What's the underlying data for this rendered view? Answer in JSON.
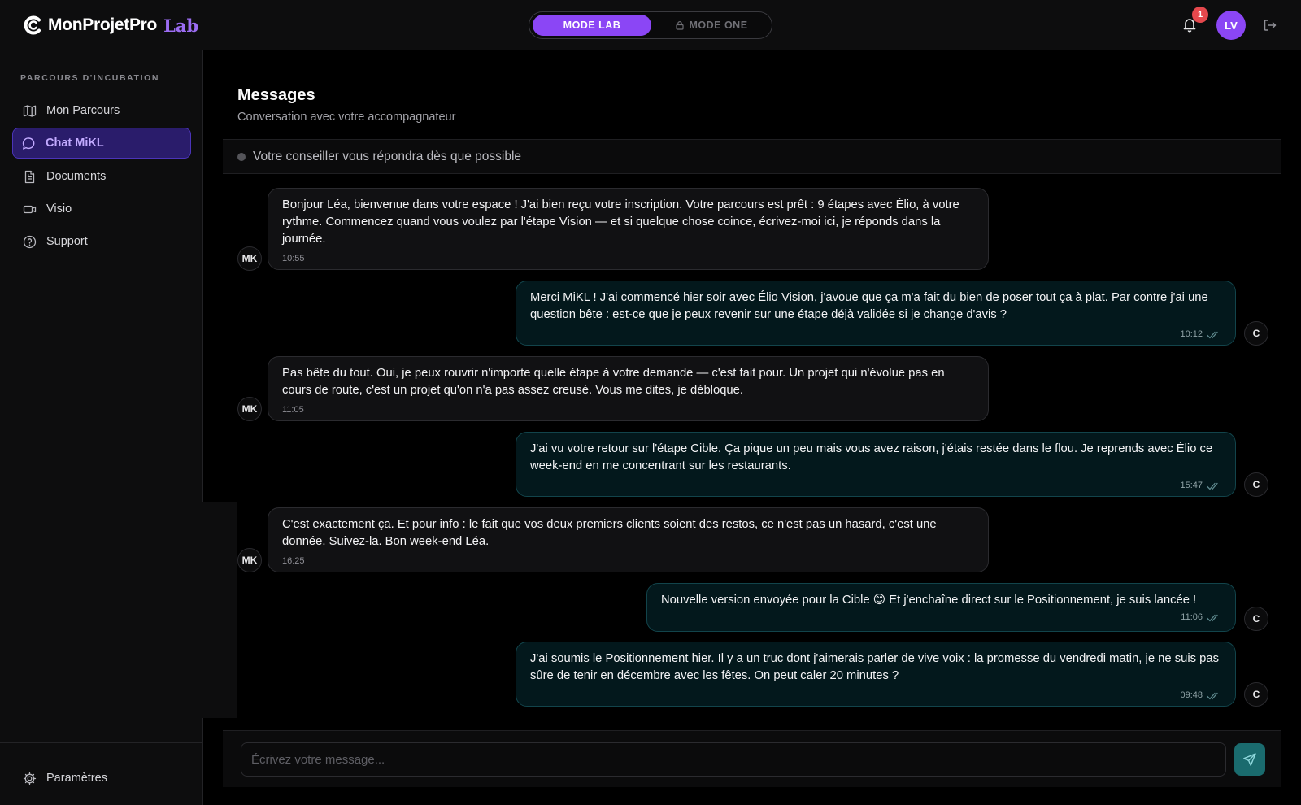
{
  "brand": {
    "name": "MonProjetPro",
    "suffix": "Lab"
  },
  "header": {
    "mode_active": "MODE LAB",
    "mode_locked": "MODE ONE",
    "notification_count": "1",
    "avatar_initials": "LV",
    "colors": {
      "accent": "#8b46f5",
      "badge": "#e5484d"
    }
  },
  "sidebar": {
    "heading": "PARCOURS D'INCUBATION",
    "items": [
      {
        "label": "Mon Parcours",
        "icon": "map-icon"
      },
      {
        "label": "Chat MiKL",
        "icon": "chat-bubble-icon",
        "active": true
      },
      {
        "label": "Documents",
        "icon": "document-icon"
      },
      {
        "label": "Visio",
        "icon": "video-icon"
      },
      {
        "label": "Support",
        "icon": "help-circle-icon"
      }
    ],
    "settings_label": "Paramètres"
  },
  "main": {
    "title": "Messages",
    "subtitle": "Conversation avec votre accompagnateur",
    "status": "Votre conseiller vous répondra dès que possible"
  },
  "messages": [
    {
      "from": "MK",
      "direction": "in",
      "text": "Bonjour Léa, bienvenue dans votre espace ! J'ai bien reçu votre inscription. Votre parcours est prêt : 9 étapes avec Élio, à votre rythme. Commencez quand vous voulez par l'étape Vision — et si quelque chose coince, écrivez-moi ici, je réponds dans la journée.",
      "time": "10:55"
    },
    {
      "from": "C",
      "direction": "out",
      "text": "Merci MiKL ! J'ai commencé hier soir avec Élio Vision, j'avoue que ça m'a fait du bien de poser tout ça à plat. Par contre j'ai une question bête : est-ce que je peux revenir sur une étape déjà validée si je change d'avis ?",
      "time": "10:12"
    },
    {
      "from": "MK",
      "direction": "in",
      "text": "Pas bête du tout. Oui, je peux rouvrir n'importe quelle étape à votre demande — c'est fait pour. Un projet qui n'évolue pas en cours de route, c'est un projet qu'on n'a pas assez creusé. Vous me dites, je débloque.",
      "time": "11:05"
    },
    {
      "from": "C",
      "direction": "out",
      "text": "J'ai vu votre retour sur l'étape Cible. Ça pique un peu mais vous avez raison, j'étais restée dans le flou. Je reprends avec Élio ce week-end en me concentrant sur les restaurants.",
      "time": "15:47"
    },
    {
      "from": "MK",
      "direction": "in",
      "text": "C'est exactement ça. Et pour info : le fait que vos deux premiers clients soient des restos, ce n'est pas un hasard, c'est une donnée. Suivez-la. Bon week-end Léa.",
      "time": "16:25"
    },
    {
      "from": "C",
      "direction": "out",
      "text": "Nouvelle version envoyée pour la Cible 😊 Et j'enchaîne direct sur le Positionnement, je suis lancée !",
      "time": "11:06"
    },
    {
      "from": "C",
      "direction": "out",
      "text": "J'ai soumis le Positionnement hier. Il y a un truc dont j'aimerais parler de vive voix : la promesse du vendredi matin, je ne suis pas sûre de tenir en décembre avec les fêtes. On peut caler 20 minutes ?",
      "time": "09:48"
    }
  ],
  "composer": {
    "placeholder": "Écrivez votre message..."
  }
}
